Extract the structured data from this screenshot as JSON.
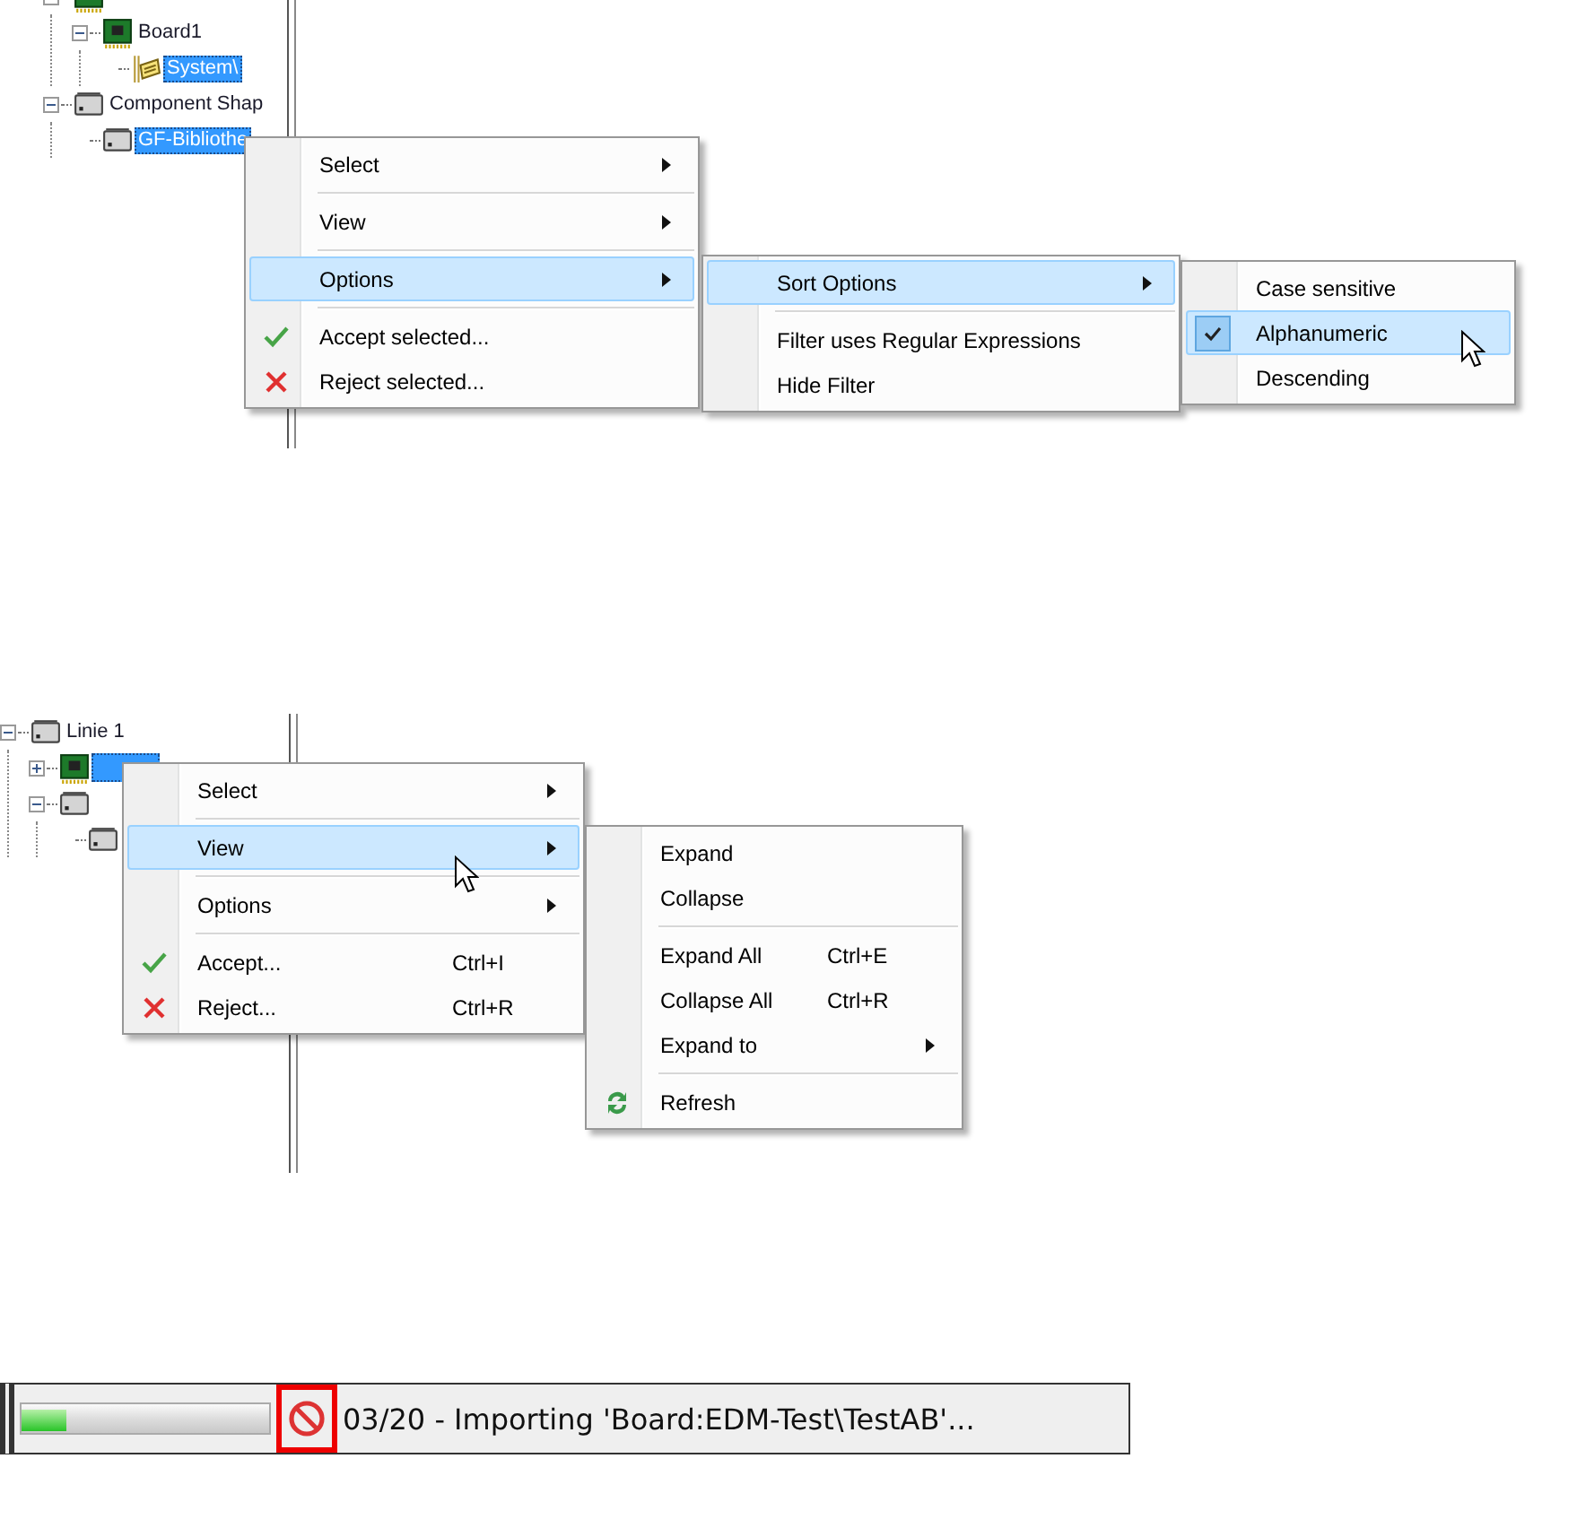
{
  "panels": [
    {
      "tree": [
        {
          "kind": "board",
          "selected": false,
          "expanded": true,
          "children": [
            {
              "label": "Board1",
              "kind": "board",
              "selected": false,
              "expanded": true,
              "children": [
                {
                  "label": "System\\",
                  "kind": "schematic",
                  "selected": true
                }
              ]
            }
          ]
        },
        {
          "label": "Component Shap",
          "kind": "component",
          "selected": false,
          "expanded": true,
          "children": [
            {
              "label": "GF-Bibliothe",
              "kind": "component",
              "selected": true
            }
          ]
        }
      ],
      "menus": [
        {
          "items": [
            {
              "kind": "item",
              "label": "Select",
              "submenu": true,
              "selected": false
            },
            {
              "kind": "separator"
            },
            {
              "kind": "item",
              "label": "View",
              "submenu": true,
              "selected": false
            },
            {
              "kind": "separator"
            },
            {
              "kind": "item",
              "label": "Options",
              "submenu": true,
              "selected": true
            },
            {
              "kind": "separator"
            },
            {
              "kind": "accept",
              "label": "Accept selected...",
              "submenu": false,
              "selected": false
            },
            {
              "kind": "reject",
              "label": "Reject selected...",
              "submenu": false,
              "selected": false
            }
          ]
        },
        {
          "items": [
            {
              "kind": "item",
              "label": "Sort Options",
              "submenu": true,
              "selected": true
            },
            {
              "kind": "separator"
            },
            {
              "kind": "item",
              "label": "Filter uses Regular Expressions",
              "submenu": false,
              "selected": false
            },
            {
              "kind": "item",
              "label": "Hide Filter",
              "submenu": false,
              "selected": false
            }
          ]
        },
        {
          "items": [
            {
              "kind": "check",
              "label": "Case sensitive",
              "checked": false,
              "selected": false
            },
            {
              "kind": "check",
              "label": "Alphanumeric",
              "checked": true,
              "selected": true
            },
            {
              "kind": "check",
              "label": "Descending",
              "checked": false,
              "selected": false
            }
          ]
        }
      ]
    },
    {
      "tree": [
        {
          "label": "Linie 1",
          "kind": "component",
          "selected": false,
          "expanded": true,
          "children": [
            {
              "kind": "board",
              "selected": true,
              "expanded": false
            },
            {
              "kind": "component",
              "selected": false,
              "expanded": true,
              "children": [
                {
                  "kind": "component",
                  "selected": false
                }
              ]
            }
          ]
        }
      ],
      "menus": [
        {
          "items": [
            {
              "kind": "item",
              "label": "Select",
              "submenu": true,
              "selected": false
            },
            {
              "kind": "separator"
            },
            {
              "kind": "item",
              "label": "View",
              "submenu": true,
              "selected": true
            },
            {
              "kind": "separator"
            },
            {
              "kind": "item",
              "label": "Options",
              "submenu": true,
              "selected": false
            },
            {
              "kind": "separator"
            },
            {
              "kind": "accept",
              "label": "Accept...",
              "shortcut": "Ctrl+I",
              "submenu": false,
              "selected": false
            },
            {
              "kind": "reject",
              "label": "Reject...",
              "shortcut": "Ctrl+R",
              "submenu": false,
              "selected": false
            }
          ]
        },
        {
          "items": [
            {
              "kind": "item",
              "label": "Expand",
              "submenu": false,
              "selected": false
            },
            {
              "kind": "item",
              "label": "Collapse",
              "submenu": false,
              "selected": false
            },
            {
              "kind": "separator"
            },
            {
              "kind": "item",
              "label": "Expand All",
              "shortcut": "Ctrl+E",
              "submenu": false,
              "selected": false
            },
            {
              "kind": "item",
              "label": "Collapse All",
              "shortcut": "Ctrl+R",
              "submenu": false,
              "selected": false
            },
            {
              "kind": "item",
              "label": "Expand to",
              "submenu": true,
              "selected": false
            },
            {
              "kind": "separator"
            },
            {
              "kind": "refresh",
              "label": "Refresh",
              "submenu": false,
              "selected": false
            }
          ]
        }
      ]
    }
  ],
  "status_bar": {
    "progress": {
      "level": 0.18
    },
    "message": "03/20 - Importing 'Board:EDM-Test\\TestAB'..."
  }
}
